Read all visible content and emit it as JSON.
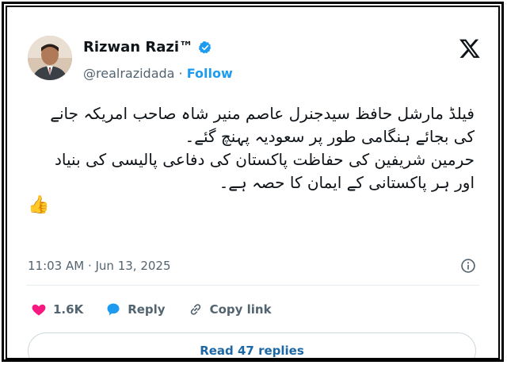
{
  "author": {
    "name": "Rizwan Razi™",
    "handle": "@realrazidada",
    "separator": " · ",
    "follow_label": "Follow"
  },
  "post": {
    "lines": [
      "فیلڈ مارشل حافظ سیدجنرل عاصم منیر شاہ صاحب امریکہ جانے",
      "کی بجائے ہنگامی طور پر سعودیہ پہنچ گئے۔",
      "حرمین شریفین کی حفاظت پاکستان کی دفاعی پالیسی کی بنیاد",
      "اور ہر پاکستانی کے ایمان کا حصہ ہے۔"
    ],
    "emoji": "👍",
    "timestamp": "11:03 AM · Jun 13, 2025"
  },
  "actions": {
    "likes_count": "1.6K",
    "reply_label": "Reply",
    "copy_link_label": "Copy link"
  },
  "replies_button_label": "Read 47 replies",
  "colors": {
    "accent": "#1d9bf0",
    "like": "#f91880",
    "muted": "#536471"
  }
}
